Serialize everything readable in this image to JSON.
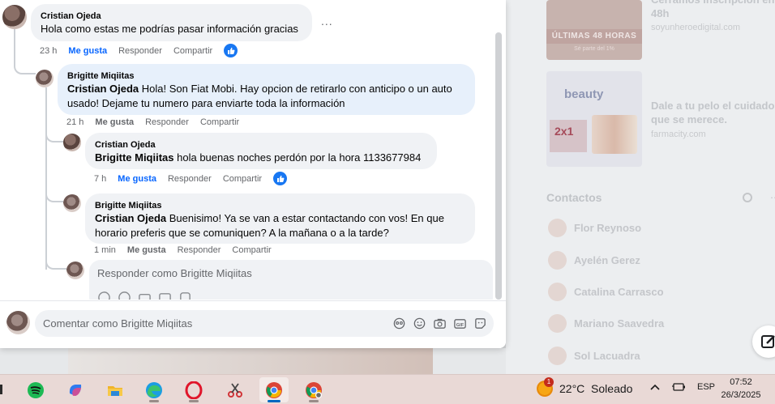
{
  "background": {
    "ads": [
      {
        "title": "Cerramos inscripción en 48h",
        "source": "soyunheroedigital.com",
        "image_band": "ÚLTIMAS 48 HORAS",
        "image_sub": "Sé parte del 1%"
      },
      {
        "title": "Dale a tu pelo el cuidado que se merece.",
        "source": "farmacity.com",
        "image_text": "beauty",
        "image_badge": "2x1"
      }
    ],
    "contacts_title": "Contactos",
    "contacts": [
      "Flor Reynoso",
      "Ayelén Gerez",
      "Catalina Carrasco",
      "Mariano Saavedra",
      "Sol Lacuadra"
    ]
  },
  "thread": {
    "more_dots": "...",
    "comments": [
      {
        "author": "Cristian Ojeda",
        "tag": "",
        "text": "Hola como estas me podrías pasar información gracias",
        "time": "23 h",
        "like": "Me gusta",
        "reply": "Responder",
        "share": "Compartir",
        "liked": true
      },
      {
        "author": "Brigitte Miqiitas",
        "tag": "Cristian Ojeda",
        "text": " Hola! Son Fiat Mobi. Hay opcion de retirarlo con anticipo o un auto usado! Dejame tu numero para enviarte toda la información",
        "time": "21 h",
        "like": "Me gusta",
        "reply": "Responder",
        "share": "Compartir",
        "liked": false
      },
      {
        "author": "Cristian Ojeda",
        "tag": "Brigitte Miqiitas",
        "text": " hola buenas noches perdón por la hora 1133677984",
        "time": "7 h",
        "like": "Me gusta",
        "reply": "Responder",
        "share": "Compartir",
        "liked": true
      },
      {
        "author": "Brigitte Miqiitas",
        "tag": "Cristian Ojeda",
        "text": " Buenisimo! Ya se van a estar contactando con vos! En que horario preferis que se comuniquen? A la mañana o a la tarde?",
        "time": "1 min",
        "like": "Me gusta",
        "reply": "Responder",
        "share": "Compartir",
        "liked": false
      }
    ],
    "reply_placeholder": "Responder como Brigitte Miqiitas",
    "comment_placeholder": "Comentar como Brigitte Miqiitas"
  },
  "taskbar": {
    "apps": [
      "spotify-icon",
      "copilot-icon",
      "file-explorer-icon",
      "edge-icon",
      "opera-icon",
      "snipping-tool-icon",
      "chrome-icon",
      "chrome-profile-icon"
    ],
    "weather_badge": "1",
    "weather": "22°C  Soleado",
    "language": "ESP",
    "time": "07:52",
    "date": "26/3/2025"
  },
  "colors": {
    "accent": "#0866ff",
    "bubble": "#f0f2f5",
    "reply_bubble": "#e7f0fb"
  }
}
